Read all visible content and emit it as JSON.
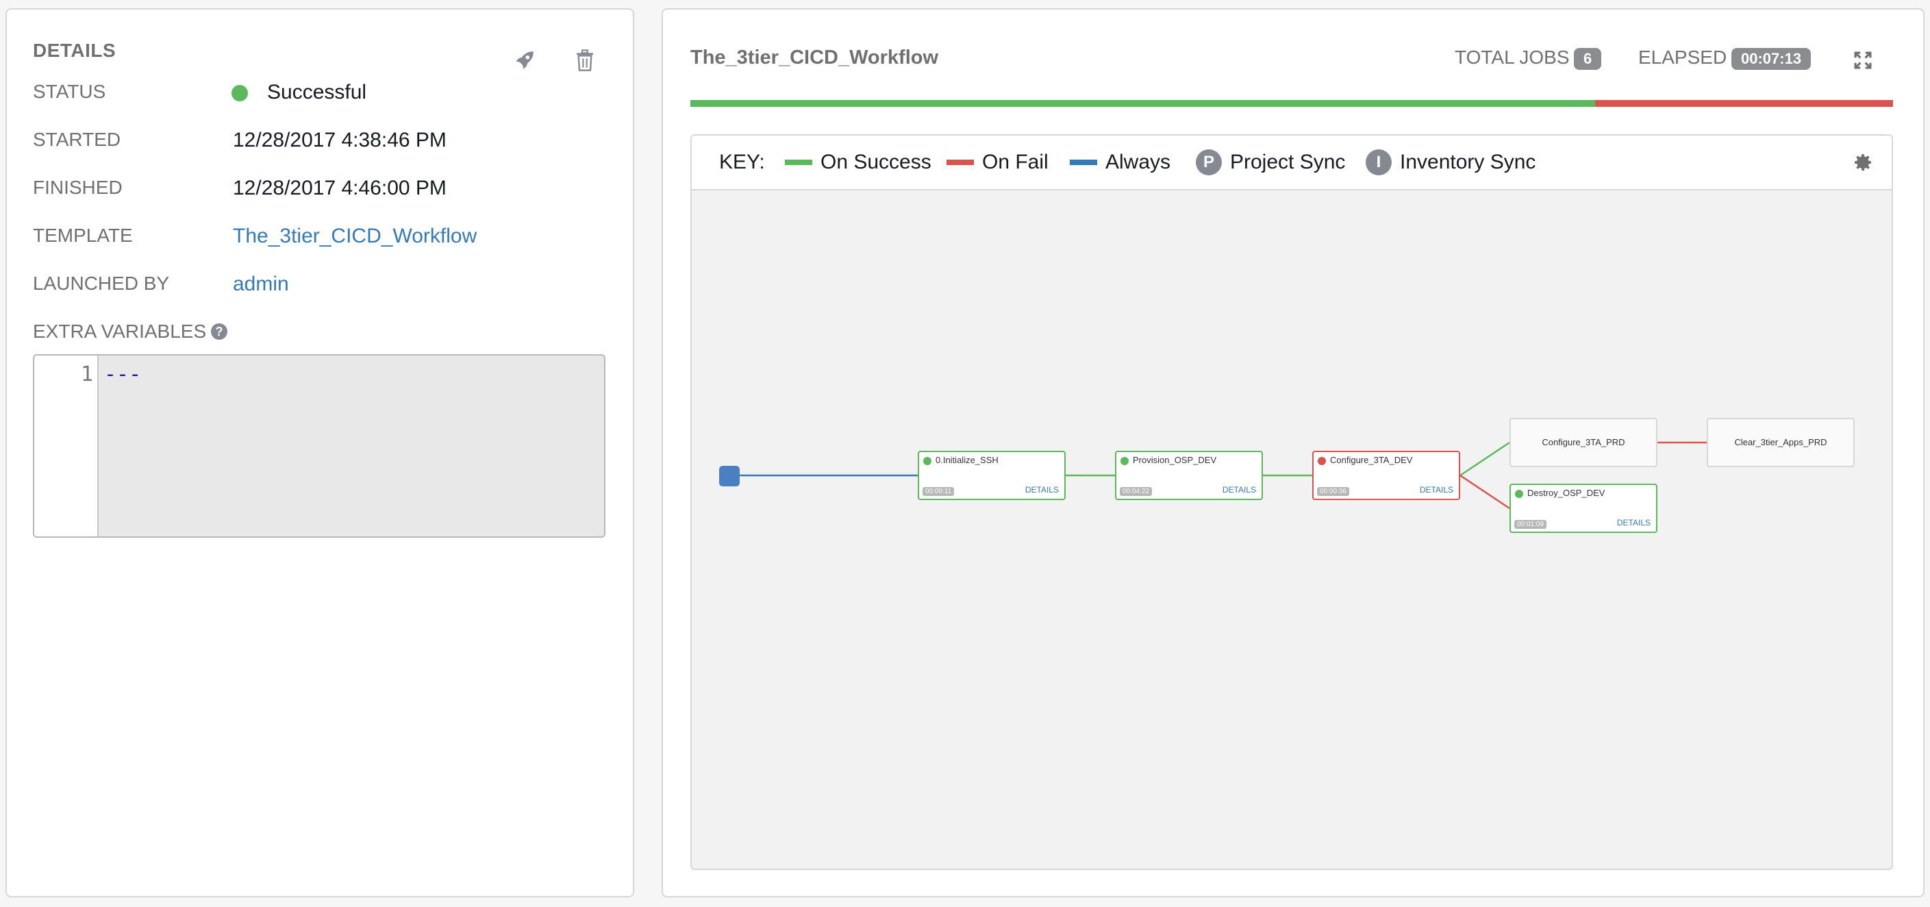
{
  "details": {
    "heading": "DETAILS",
    "status_label": "STATUS",
    "status_value": "Successful",
    "started_label": "STARTED",
    "started_value": "12/28/2017 4:38:46 PM",
    "finished_label": "FINISHED",
    "finished_value": "12/28/2017 4:46:00 PM",
    "template_label": "TEMPLATE",
    "template_value": "The_3tier_CICD_Workflow",
    "launched_by_label": "LAUNCHED BY",
    "launched_by_value": "admin",
    "extra_vars_label": "EXTRA VARIABLES",
    "code_line_number": "1",
    "code_text": "---",
    "icons": [
      "rocket-icon",
      "trash-icon",
      "help-icon"
    ]
  },
  "workflow": {
    "title": "The_3tier_CICD_Workflow",
    "total_jobs_label": "TOTAL JOBS",
    "total_jobs_value": "6",
    "elapsed_label": "ELAPSED",
    "elapsed_value": "00:07:13",
    "progress_success_fraction": 0.752,
    "colors": {
      "success": "#5cb85c",
      "fail": "#d9534f",
      "always": "#337ab7",
      "start": "#4a7fc1"
    },
    "key": {
      "label": "KEY:",
      "on_success": "On Success",
      "on_fail": "On Fail",
      "always": "Always",
      "project_sync_letter": "P",
      "project_sync": "Project Sync",
      "inventory_sync_letter": "I",
      "inventory_sync": "Inventory Sync"
    },
    "nodes": [
      {
        "name": "0.Initialize_SSH",
        "time": "00:00:11",
        "details": "DETAILS",
        "status": "success"
      },
      {
        "name": "Provision_OSP_DEV",
        "time": "00:04:22",
        "details": "DETAILS",
        "status": "success"
      },
      {
        "name": "Configure_3TA_DEV",
        "time": "00:00:36",
        "details": "DETAILS",
        "status": "failed"
      },
      {
        "name": "Configure_3TA_PRD",
        "status": "not-run"
      },
      {
        "name": "Destroy_OSP_DEV",
        "time": "00:01:09",
        "details": "DETAILS",
        "status": "success"
      },
      {
        "name": "Clear_3tier_Apps_PRD",
        "status": "not-run"
      }
    ]
  }
}
